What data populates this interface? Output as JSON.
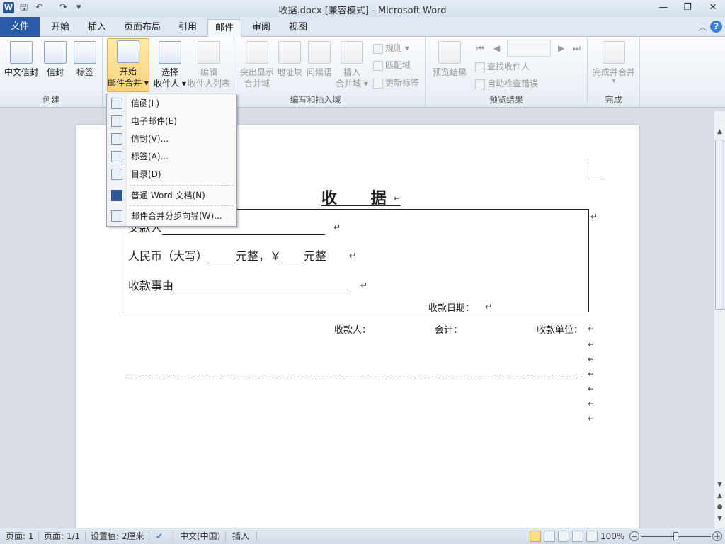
{
  "titlebar": {
    "app_icon_letter": "W",
    "title": "收据.docx [兼容模式]  -  Microsoft Word",
    "qat": {
      "save": "🖫",
      "undo": "↶",
      "redo": "↷",
      "customize": "▾"
    },
    "win": {
      "minimize": "—",
      "restore": "❐",
      "close": "✕"
    }
  },
  "tabs": {
    "file": "文件",
    "items": [
      "开始",
      "插入",
      "页面布局",
      "引用",
      "邮件",
      "审阅",
      "视图"
    ],
    "active": "邮件",
    "help": "?",
    "collapse": "︿"
  },
  "ribbon": {
    "create": {
      "label": "创建",
      "buttons": [
        "中文信封",
        "信封",
        "标签"
      ]
    },
    "start": {
      "start_line1": "开始",
      "start_line2": "邮件合并 ▾",
      "select_line1": "选择",
      "select_line2": "收件人 ▾",
      "edit_line1": "编辑",
      "edit_line2": "收件人列表"
    },
    "write": {
      "label": "编写和插入域",
      "highlight_line1": "突出显示",
      "highlight_line2": "合并域",
      "address_block": "地址块",
      "greeting": "问候语",
      "insert_line1": "插入",
      "insert_line2": "合并域 ▾",
      "rules": "规则 ▾",
      "match_fields": "匹配域",
      "update_labels": "更新标签"
    },
    "preview": {
      "label": "预览结果",
      "preview_button": "预览结果",
      "first": "⏮",
      "prev": "◀",
      "next": "▶",
      "last": "⏭",
      "find_recipient": "查找收件人",
      "auto_check": "自动检查错误"
    },
    "finish": {
      "label": "完成",
      "button": "完成并合并",
      "arrow": "▾"
    }
  },
  "dropdown": {
    "items": [
      {
        "label": "信函(L)",
        "icon": "letter-icon"
      },
      {
        "label": "电子邮件(E)",
        "icon": "email-icon"
      },
      {
        "label": "信封(V)...",
        "icon": "envelope-icon"
      },
      {
        "label": "标签(A)...",
        "icon": "labels-icon"
      },
      {
        "label": "目录(D)",
        "icon": "directory-icon"
      },
      {
        "label": "普通 Word 文档(N)",
        "icon": "word-doc-icon"
      },
      {
        "label": "邮件合并分步向导(W)...",
        "icon": "wizard-icon"
      }
    ]
  },
  "document": {
    "title": "收  据",
    "title_mark": "↵",
    "row1_label": "交款人",
    "row2_prefix": "人民币（大写）",
    "row2_mid": "元整，￥",
    "row2_suffix": "元整",
    "row3_label": "收款事由",
    "date_label": "收款日期：",
    "payee": "收款人：",
    "accountant": "会计：",
    "unit": "收款单位：",
    "para_mark": "↵"
  },
  "statusbar": {
    "page": "页面: 1",
    "pages": "页面: 1/1",
    "setting": "设置值: 2厘米",
    "language": "中文(中国)",
    "insert_mode": "插入",
    "zoom": "100%",
    "zoom_minus": "−",
    "zoom_plus": "+"
  },
  "colors": {
    "file_tab": "#2a5ba8",
    "pressed": "#f8d37a",
    "accent": "#3c7fd3"
  }
}
